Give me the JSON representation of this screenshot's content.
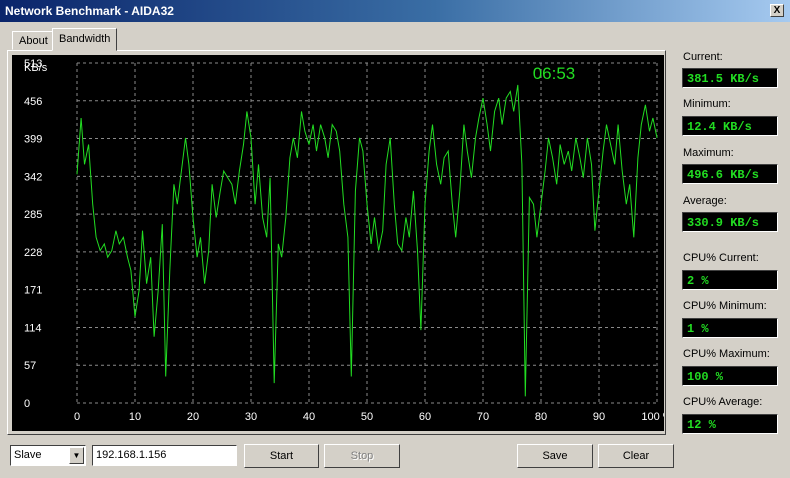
{
  "window": {
    "title": "Network Benchmark - AIDA32",
    "close_glyph": "X"
  },
  "tabs": [
    {
      "label": "About",
      "active": false
    },
    {
      "label": "Bandwidth",
      "active": true
    }
  ],
  "stats": {
    "current_label": "Current:",
    "current_value": "381.5 KB/s",
    "minimum_label": "Minimum:",
    "minimum_value": "12.4 KB/s",
    "maximum_label": "Maximum:",
    "maximum_value": "496.6 KB/s",
    "average_label": "Average:",
    "average_value": "330.9 KB/s",
    "cpu_current_label": "CPU% Current:",
    "cpu_current_value": "2 %",
    "cpu_minimum_label": "CPU% Minimum:",
    "cpu_minimum_value": "1 %",
    "cpu_maximum_label": "CPU% Maximum:",
    "cpu_maximum_value": "100 %",
    "cpu_average_label": "CPU% Average:",
    "cpu_average_value": "12 %"
  },
  "controls": {
    "mode_select_value": "Slave",
    "mode_arrow_glyph": "▼",
    "address_value": "192.168.1.156",
    "start_label": "Start",
    "stop_label": "Stop",
    "save_label": "Save",
    "clear_label": "Clear"
  },
  "colors": {
    "chart_background": "#000000",
    "grid": "#8a8a8a",
    "trace": "#22dd22",
    "timer": "#22dd22",
    "axis_text": "#ffffff"
  },
  "chart_data": {
    "type": "line",
    "elapsed_time": "06:53",
    "ylabel": "KB/s",
    "yticks": [
      "513",
      "456",
      "399",
      "342",
      "285",
      "228",
      "171",
      "114",
      "57",
      "0"
    ],
    "xticks": [
      "0",
      "10",
      "20",
      "30",
      "40",
      "50",
      "60",
      "70",
      "80",
      "90",
      "100 %"
    ],
    "xlim": [
      0,
      100
    ],
    "ylim": [
      0,
      513
    ],
    "grid": true,
    "series": [
      {
        "values": [
          [
            0,
            345
          ],
          [
            0.7,
            430
          ],
          [
            1.3,
            360
          ],
          [
            2,
            390
          ],
          [
            2.7,
            300
          ],
          [
            3.3,
            250
          ],
          [
            4,
            230
          ],
          [
            4.7,
            240
          ],
          [
            5.3,
            220
          ],
          [
            6,
            230
          ],
          [
            6.7,
            260
          ],
          [
            7.3,
            240
          ],
          [
            8,
            250
          ],
          [
            8.7,
            220
          ],
          [
            9.3,
            200
          ],
          [
            10,
            130
          ],
          [
            10.7,
            170
          ],
          [
            11.3,
            260
          ],
          [
            12,
            180
          ],
          [
            12.7,
            220
          ],
          [
            13.3,
            100
          ],
          [
            14,
            170
          ],
          [
            14.7,
            270
          ],
          [
            15.3,
            40
          ],
          [
            16,
            200
          ],
          [
            16.7,
            330
          ],
          [
            17.3,
            300
          ],
          [
            18,
            350
          ],
          [
            18.7,
            400
          ],
          [
            19.3,
            360
          ],
          [
            20,
            280
          ],
          [
            20.7,
            220
          ],
          [
            21.3,
            250
          ],
          [
            22,
            180
          ],
          [
            22.7,
            230
          ],
          [
            23.3,
            330
          ],
          [
            24,
            280
          ],
          [
            24.7,
            320
          ],
          [
            25.3,
            350
          ],
          [
            26,
            340
          ],
          [
            26.7,
            330
          ],
          [
            27.3,
            300
          ],
          [
            28,
            350
          ],
          [
            28.7,
            390
          ],
          [
            29.3,
            440
          ],
          [
            30,
            400
          ],
          [
            30.7,
            300
          ],
          [
            31.3,
            360
          ],
          [
            32,
            280
          ],
          [
            32.7,
            250
          ],
          [
            33.3,
            340
          ],
          [
            34,
            30
          ],
          [
            34.7,
            240
          ],
          [
            35.3,
            220
          ],
          [
            36,
            280
          ],
          [
            36.7,
            370
          ],
          [
            37.3,
            400
          ],
          [
            38,
            370
          ],
          [
            38.7,
            440
          ],
          [
            39.3,
            410
          ],
          [
            40,
            390
          ],
          [
            40.7,
            420
          ],
          [
            41.3,
            380
          ],
          [
            42,
            420
          ],
          [
            42.7,
            400
          ],
          [
            43.3,
            370
          ],
          [
            44,
            420
          ],
          [
            44.7,
            410
          ],
          [
            45.3,
            380
          ],
          [
            46,
            300
          ],
          [
            46.7,
            250
          ],
          [
            47.3,
            40
          ],
          [
            48,
            320
          ],
          [
            48.7,
            400
          ],
          [
            49.3,
            380
          ],
          [
            50,
            300
          ],
          [
            50.7,
            240
          ],
          [
            51.3,
            280
          ],
          [
            52,
            230
          ],
          [
            52.7,
            260
          ],
          [
            53.3,
            360
          ],
          [
            54,
            400
          ],
          [
            54.7,
            300
          ],
          [
            55.3,
            240
          ],
          [
            56,
            230
          ],
          [
            56.7,
            280
          ],
          [
            57.3,
            250
          ],
          [
            58,
            320
          ],
          [
            58.7,
            230
          ],
          [
            59.3,
            110
          ],
          [
            60,
            300
          ],
          [
            60.7,
            380
          ],
          [
            61.3,
            420
          ],
          [
            62,
            360
          ],
          [
            62.7,
            330
          ],
          [
            63.3,
            370
          ],
          [
            64,
            380
          ],
          [
            64.7,
            300
          ],
          [
            65.3,
            250
          ],
          [
            66,
            320
          ],
          [
            66.7,
            420
          ],
          [
            67.3,
            380
          ],
          [
            68,
            340
          ],
          [
            68.7,
            400
          ],
          [
            69.3,
            430
          ],
          [
            70,
            460
          ],
          [
            70.7,
            420
          ],
          [
            71.3,
            380
          ],
          [
            72,
            440
          ],
          [
            72.7,
            460
          ],
          [
            73.3,
            420
          ],
          [
            74,
            460
          ],
          [
            74.7,
            470
          ],
          [
            75.3,
            440
          ],
          [
            76,
            480
          ],
          [
            76.7,
            360
          ],
          [
            77.3,
            10
          ],
          [
            78,
            310
          ],
          [
            78.7,
            300
          ],
          [
            79.3,
            250
          ],
          [
            80,
            300
          ],
          [
            80.7,
            350
          ],
          [
            81.3,
            400
          ],
          [
            82,
            370
          ],
          [
            82.7,
            330
          ],
          [
            83.3,
            390
          ],
          [
            84,
            360
          ],
          [
            84.7,
            380
          ],
          [
            85.3,
            350
          ],
          [
            86,
            400
          ],
          [
            86.7,
            370
          ],
          [
            87.3,
            340
          ],
          [
            88,
            400
          ],
          [
            88.7,
            360
          ],
          [
            89.3,
            260
          ],
          [
            90,
            320
          ],
          [
            90.7,
            380
          ],
          [
            91.3,
            420
          ],
          [
            92,
            390
          ],
          [
            92.7,
            360
          ],
          [
            93.3,
            420
          ],
          [
            94,
            350
          ],
          [
            94.7,
            300
          ],
          [
            95.3,
            330
          ],
          [
            96,
            250
          ],
          [
            96.7,
            370
          ],
          [
            97.3,
            420
          ],
          [
            98,
            450
          ],
          [
            98.7,
            410
          ],
          [
            99.3,
            430
          ],
          [
            100,
            400
          ]
        ]
      }
    ]
  }
}
